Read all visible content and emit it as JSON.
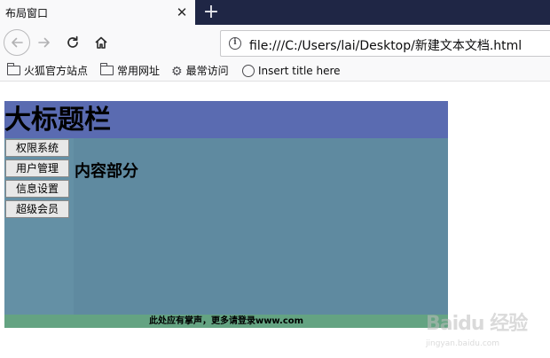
{
  "browser": {
    "tab": {
      "title": "布局窗口",
      "close_glyph": "✕"
    },
    "new_tab_glyph": "+",
    "nav": {
      "back_icon": "back-arrow-icon",
      "forward_icon": "forward-arrow-icon",
      "reload_icon": "reload-icon",
      "home_icon": "home-icon"
    },
    "url": {
      "info_glyph": "i",
      "text": "file:///C:/Users/lai/Desktop/新建文本文档.html"
    },
    "bookmarks": [
      {
        "label": "火狐官方站点",
        "icon": "folder-icon"
      },
      {
        "label": "常用网址",
        "icon": "folder-icon"
      },
      {
        "label": "最常访问",
        "icon": "gear-icon"
      },
      {
        "label": "Insert title here",
        "icon": "globe-icon"
      }
    ]
  },
  "page": {
    "header": {
      "title": "大标题栏",
      "color": "#5a6bb1"
    },
    "sidebar": {
      "color": "#6490a5",
      "buttons": [
        "权限系统",
        "用户管理",
        "信息设置",
        "超级会员"
      ]
    },
    "main": {
      "title": "内容部分",
      "color": "#5f8aa0"
    },
    "footer": {
      "text": "此处应有掌声，更多请登录www.com",
      "color": "#64a382"
    }
  },
  "watermark": {
    "main": "Baidu 经验",
    "sub": "jingyan.baidu.com"
  }
}
